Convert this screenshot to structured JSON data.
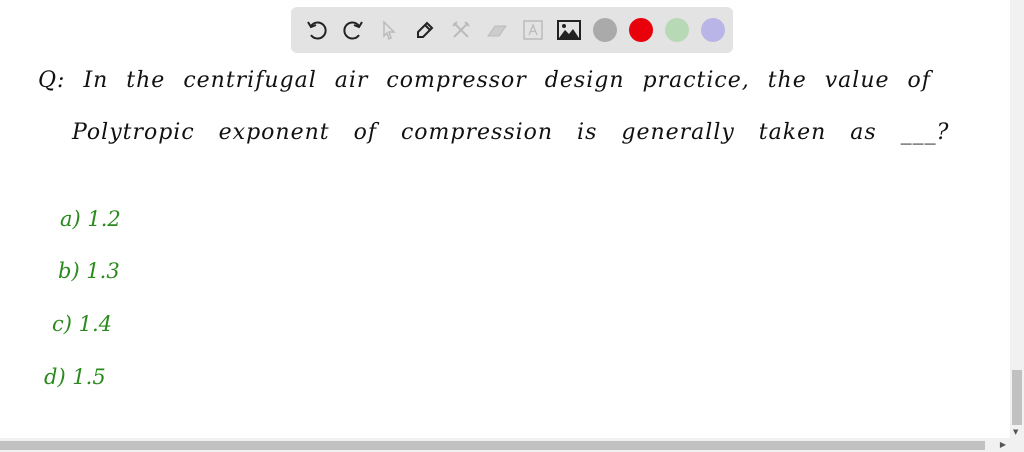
{
  "toolbar": {
    "tools": [
      "undo",
      "redo",
      "select",
      "pen",
      "tools",
      "eraser",
      "text",
      "image"
    ],
    "colors": [
      "#aaaaaa",
      "#e8000b",
      "#b8d9b5",
      "#b9b5e6"
    ]
  },
  "question": {
    "line1": "Q: In the centrifugal air compressor design practice, the value of",
    "line2": "Polytropic exponent of compression is generally taken as ___?"
  },
  "options": [
    "a) 1.2",
    "b) 1.3",
    "c) 1.4",
    "d) 1.5"
  ],
  "colors": {
    "question": "#111111",
    "options": "#2a8a1e"
  }
}
